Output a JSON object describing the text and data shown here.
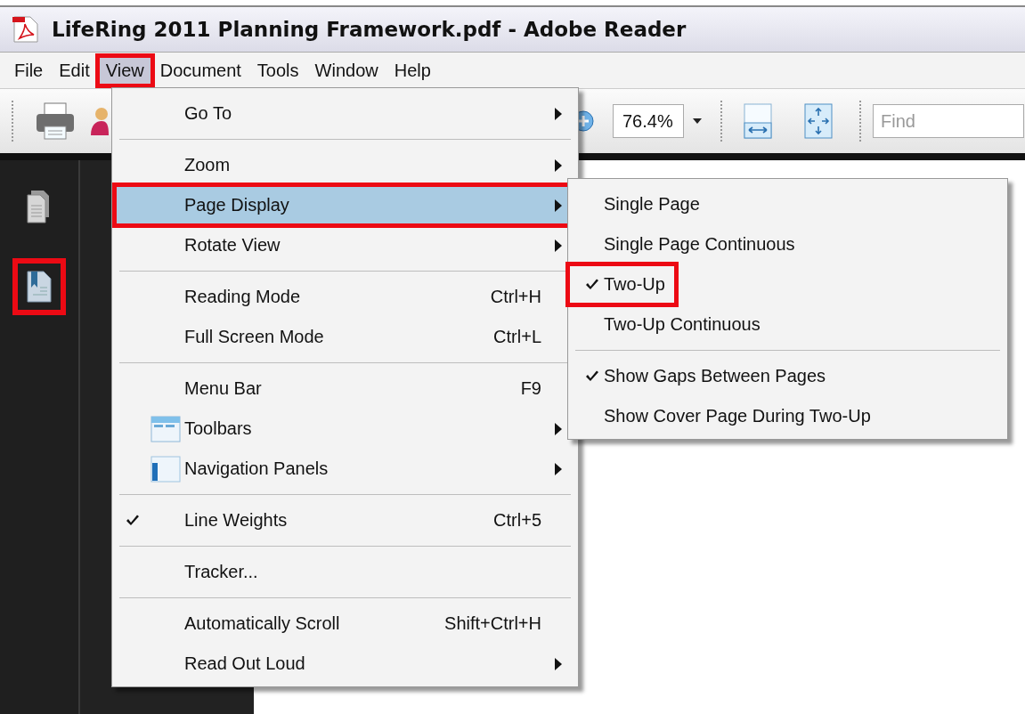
{
  "window": {
    "title": "LifeRing 2011 Planning Framework.pdf - Adobe Reader"
  },
  "menu_bar": [
    {
      "label": "File",
      "selected": false,
      "annotated": false
    },
    {
      "label": "Edit",
      "selected": false,
      "annotated": false
    },
    {
      "label": "View",
      "selected": true,
      "annotated": true
    },
    {
      "label": "Document",
      "selected": false,
      "annotated": false
    },
    {
      "label": "Tools",
      "selected": false,
      "annotated": false
    },
    {
      "label": "Window",
      "selected": false,
      "annotated": false
    },
    {
      "label": "Help",
      "selected": false,
      "annotated": false
    }
  ],
  "toolbar": {
    "zoom": "76.4%",
    "find": {
      "placeholder": "Find"
    }
  },
  "nav_panel": [
    {
      "kind": "pages",
      "annotated": false
    },
    {
      "kind": "bookmarks",
      "annotated": true
    }
  ],
  "view_menu": [
    {
      "kind": "item",
      "label": "Go To",
      "submenu": true,
      "checked": false,
      "selected": false,
      "annotated": false
    },
    {
      "kind": "separator"
    },
    {
      "kind": "item",
      "label": "Zoom",
      "submenu": true,
      "checked": false,
      "selected": false,
      "annotated": false
    },
    {
      "kind": "item",
      "label": "Page Display",
      "submenu": true,
      "checked": false,
      "selected": true,
      "annotated": true
    },
    {
      "kind": "item",
      "label": "Rotate View",
      "submenu": true,
      "checked": false,
      "selected": false,
      "annotated": false
    },
    {
      "kind": "separator"
    },
    {
      "kind": "item",
      "label": "Reading Mode",
      "shortcut": "Ctrl+H",
      "submenu": false,
      "checked": false,
      "selected": false,
      "annotated": false
    },
    {
      "kind": "item",
      "label": "Full Screen Mode",
      "shortcut": "Ctrl+L",
      "submenu": false,
      "checked": false,
      "selected": false,
      "annotated": false
    },
    {
      "kind": "separator"
    },
    {
      "kind": "item",
      "label": "Menu Bar",
      "shortcut": "F9",
      "submenu": false,
      "checked": false,
      "selected": false,
      "annotated": false
    },
    {
      "kind": "icon_item",
      "label": "Toolbars",
      "submenu": true,
      "checked": false,
      "selected": false,
      "annotated": false
    },
    {
      "kind": "icon_item",
      "label": "Navigation Panels",
      "submenu": true,
      "checked": false,
      "selected": false,
      "annotated": false
    },
    {
      "kind": "separator"
    },
    {
      "kind": "item",
      "label": "Line Weights",
      "shortcut": "Ctrl+5",
      "submenu": false,
      "checked": true,
      "selected": false,
      "annotated": false
    },
    {
      "kind": "separator"
    },
    {
      "kind": "item",
      "label": "Tracker...",
      "submenu": false,
      "checked": false,
      "selected": false,
      "annotated": false
    },
    {
      "kind": "separator"
    },
    {
      "kind": "item",
      "label": "Automatically Scroll",
      "shortcut": "Shift+Ctrl+H",
      "submenu": false,
      "checked": false,
      "selected": false,
      "annotated": false
    },
    {
      "kind": "item",
      "label": "Read Out Loud",
      "submenu": true,
      "checked": false,
      "selected": false,
      "annotated": false
    }
  ],
  "page_display_menu": [
    {
      "kind": "item",
      "label": "Single Page",
      "checked": false,
      "annotated": false
    },
    {
      "kind": "item",
      "label": "Single Page Continuous",
      "checked": false,
      "annotated": false
    },
    {
      "kind": "item",
      "label": "Two-Up",
      "checked": true,
      "annotated": true
    },
    {
      "kind": "item",
      "label": "Two-Up Continuous",
      "checked": false,
      "annotated": false
    },
    {
      "kind": "separator"
    },
    {
      "kind": "item",
      "label": "Show Gaps Between Pages",
      "checked": true,
      "annotated": false
    },
    {
      "kind": "item",
      "label": "Show Cover Page During Two-Up",
      "checked": false,
      "annotated": false
    }
  ]
}
